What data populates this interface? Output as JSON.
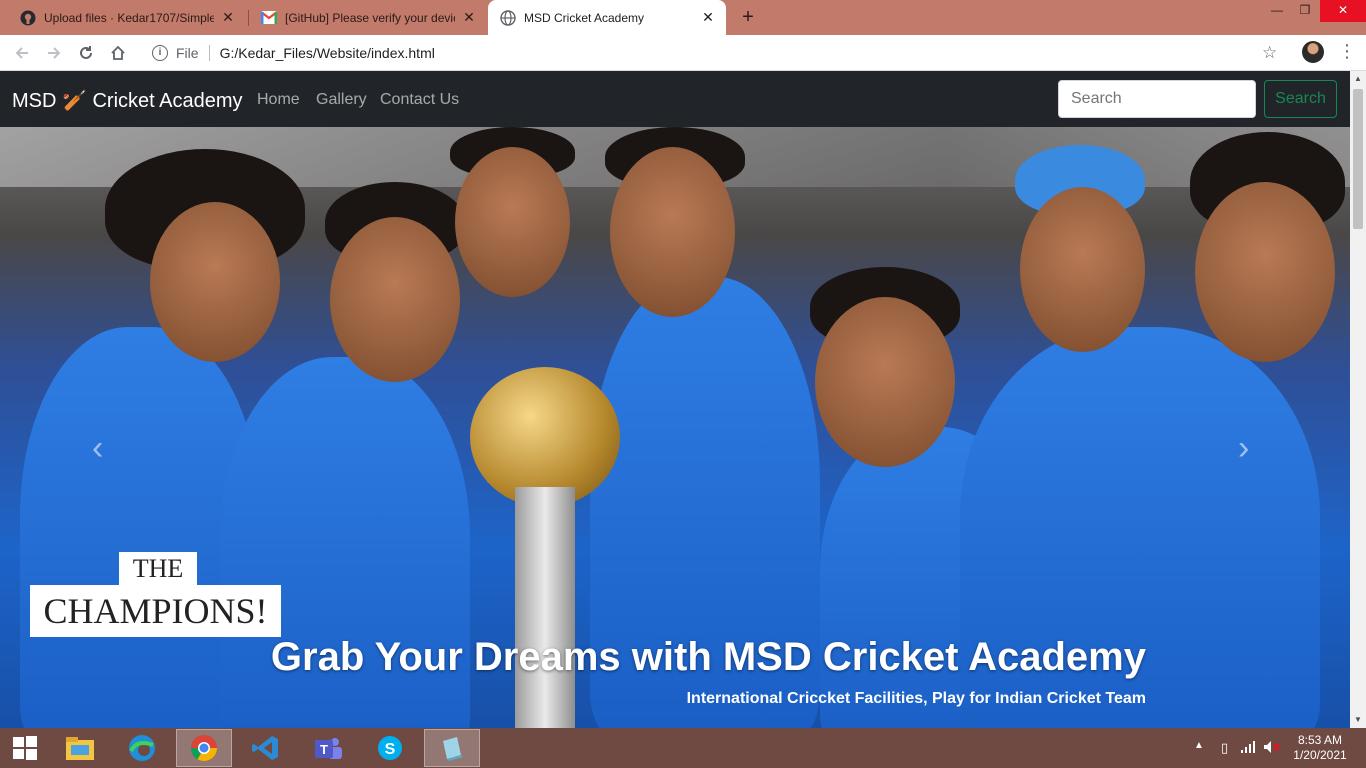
{
  "browser": {
    "tabs": [
      {
        "title": "Upload files · Kedar1707/Simple-",
        "icon": "github-icon",
        "active": false
      },
      {
        "title": "[GitHub] Please verify your device",
        "icon": "gmail-icon",
        "active": false
      },
      {
        "title": "MSD Cricket Academy",
        "icon": "globe-icon",
        "active": true
      }
    ],
    "new_tab_label": "+",
    "address": {
      "scheme_label": "File",
      "url": "G:/Kedar_Files/Website/index.html"
    }
  },
  "site": {
    "brand": "MSD 🏏 Cricket Academy",
    "nav_links": [
      "Home",
      "Gallery",
      "Contact Us"
    ],
    "search_placeholder": "Search",
    "search_button": "Search"
  },
  "hero": {
    "image_text_the": "THE",
    "image_text_champions": "CHAMPIONS!",
    "title": "Grab Your Dreams with MSD Cricket Academy",
    "subtitle": "International Criccket Facilities, Play for Indian Cricket Team",
    "prev_label": "‹",
    "next_label": "›"
  },
  "taskbar": {
    "time": "8:53 AM",
    "date": "1/20/2021",
    "apps": [
      "file-explorer-icon",
      "edge-icon",
      "chrome-icon",
      "vscode-icon",
      "teams-icon",
      "skype-icon",
      "notepad-icon"
    ]
  },
  "colors": {
    "tabstrip": "#c27a6a",
    "navbar": "#212529",
    "success": "#198754",
    "taskbar": "#6e4a43"
  }
}
